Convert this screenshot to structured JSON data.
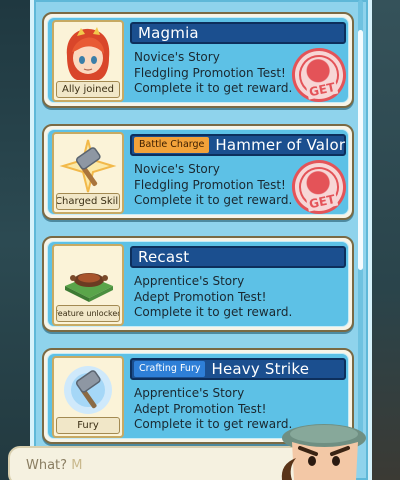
{
  "quests": [
    {
      "title": "Magmia",
      "badge": "",
      "caption": "Ally joined",
      "icon": "girl-portrait-icon",
      "story": "Novice's Story",
      "test": "Fledgling Promotion Test!",
      "reward": "Complete it to get reward.",
      "get_label": "GET",
      "claimable": true
    },
    {
      "title": "Hammer of Valor",
      "badge": "Battle Charge",
      "badge_color": "#f2a23a",
      "caption": "Charged Skill",
      "icon": "hammer-star-icon",
      "story": "Novice's Story",
      "test": "Fledgling Promotion Test!",
      "reward": "Complete it to get reward.",
      "get_label": "GET",
      "claimable": true
    },
    {
      "title": "Recast",
      "badge": "",
      "caption": "Feature unlocked",
      "icon": "forge-icon",
      "story": "Apprentice's Story",
      "test": "Adept Promotion Test!",
      "reward": "Complete it to get reward.",
      "claimable": false
    },
    {
      "title": "Heavy Strike",
      "badge": "Crafting Fury",
      "badge_color": "#2e7fd7",
      "caption": "Fury",
      "icon": "hammer-glow-icon",
      "story": "Apprentice's Story",
      "test": "Adept Promotion Test!",
      "reward": "Complete it to get reward.",
      "claimable": false
    }
  ],
  "dialog": {
    "text": "What?",
    "cursor": "M"
  },
  "colors": {
    "panel": "#8fd3ec",
    "card_inner": "#5dc1e6",
    "title_bar": "#1b4f8f",
    "get_red": "#e45358"
  }
}
